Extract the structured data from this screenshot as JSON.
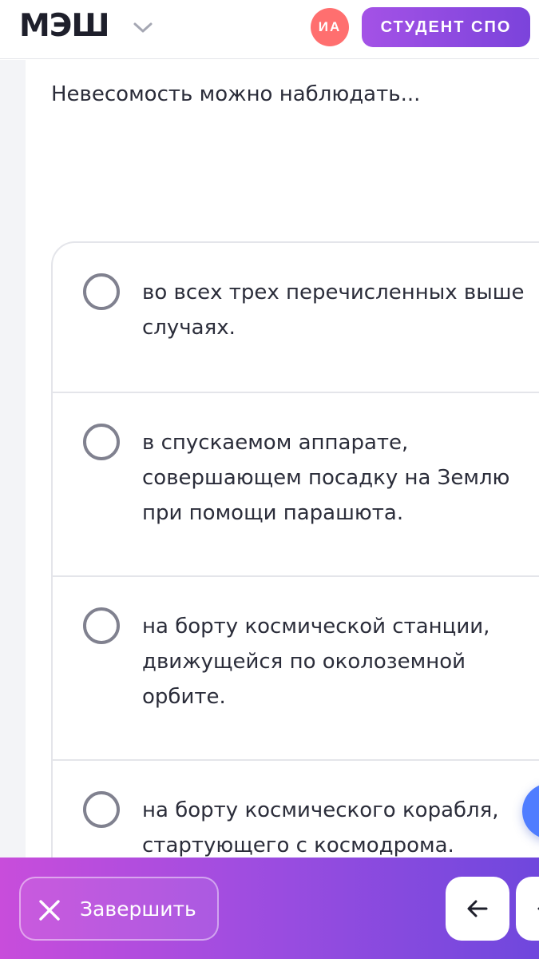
{
  "header": {
    "logo": "МЭШ",
    "avatar_initials": "ИА",
    "role": "СТУДЕНТ СПО",
    "icons": {
      "logo_menu": "chevron-down-icon"
    }
  },
  "question": {
    "text": "Невесомость можно наблюдать..."
  },
  "options": [
    {
      "label": "во всех трех перечисленных выше случаях.",
      "selected": false
    },
    {
      "label": "в спускаемом аппарате, совершающем посадку на Землю при помощи парашюта.",
      "selected": false
    },
    {
      "label": "на борту космической станции, движущейся по околоземной орбите.",
      "selected": false
    },
    {
      "label": "на борту космического корабля, стартующего с космодрома.",
      "selected": false
    }
  ],
  "footer": {
    "finish_label": "Завершить",
    "icons": {
      "finish": "close-icon",
      "prev": "arrow-left-icon",
      "next": "arrow-right-icon"
    }
  },
  "colors": {
    "avatar": "#ff6f6f",
    "badge_gradient": [
      "#a452e6",
      "#7b43db"
    ],
    "footer_gradient": [
      "#c84ddb",
      "#6f47dd"
    ],
    "fab": "#4f7dff",
    "radio_border": "#80818f"
  }
}
